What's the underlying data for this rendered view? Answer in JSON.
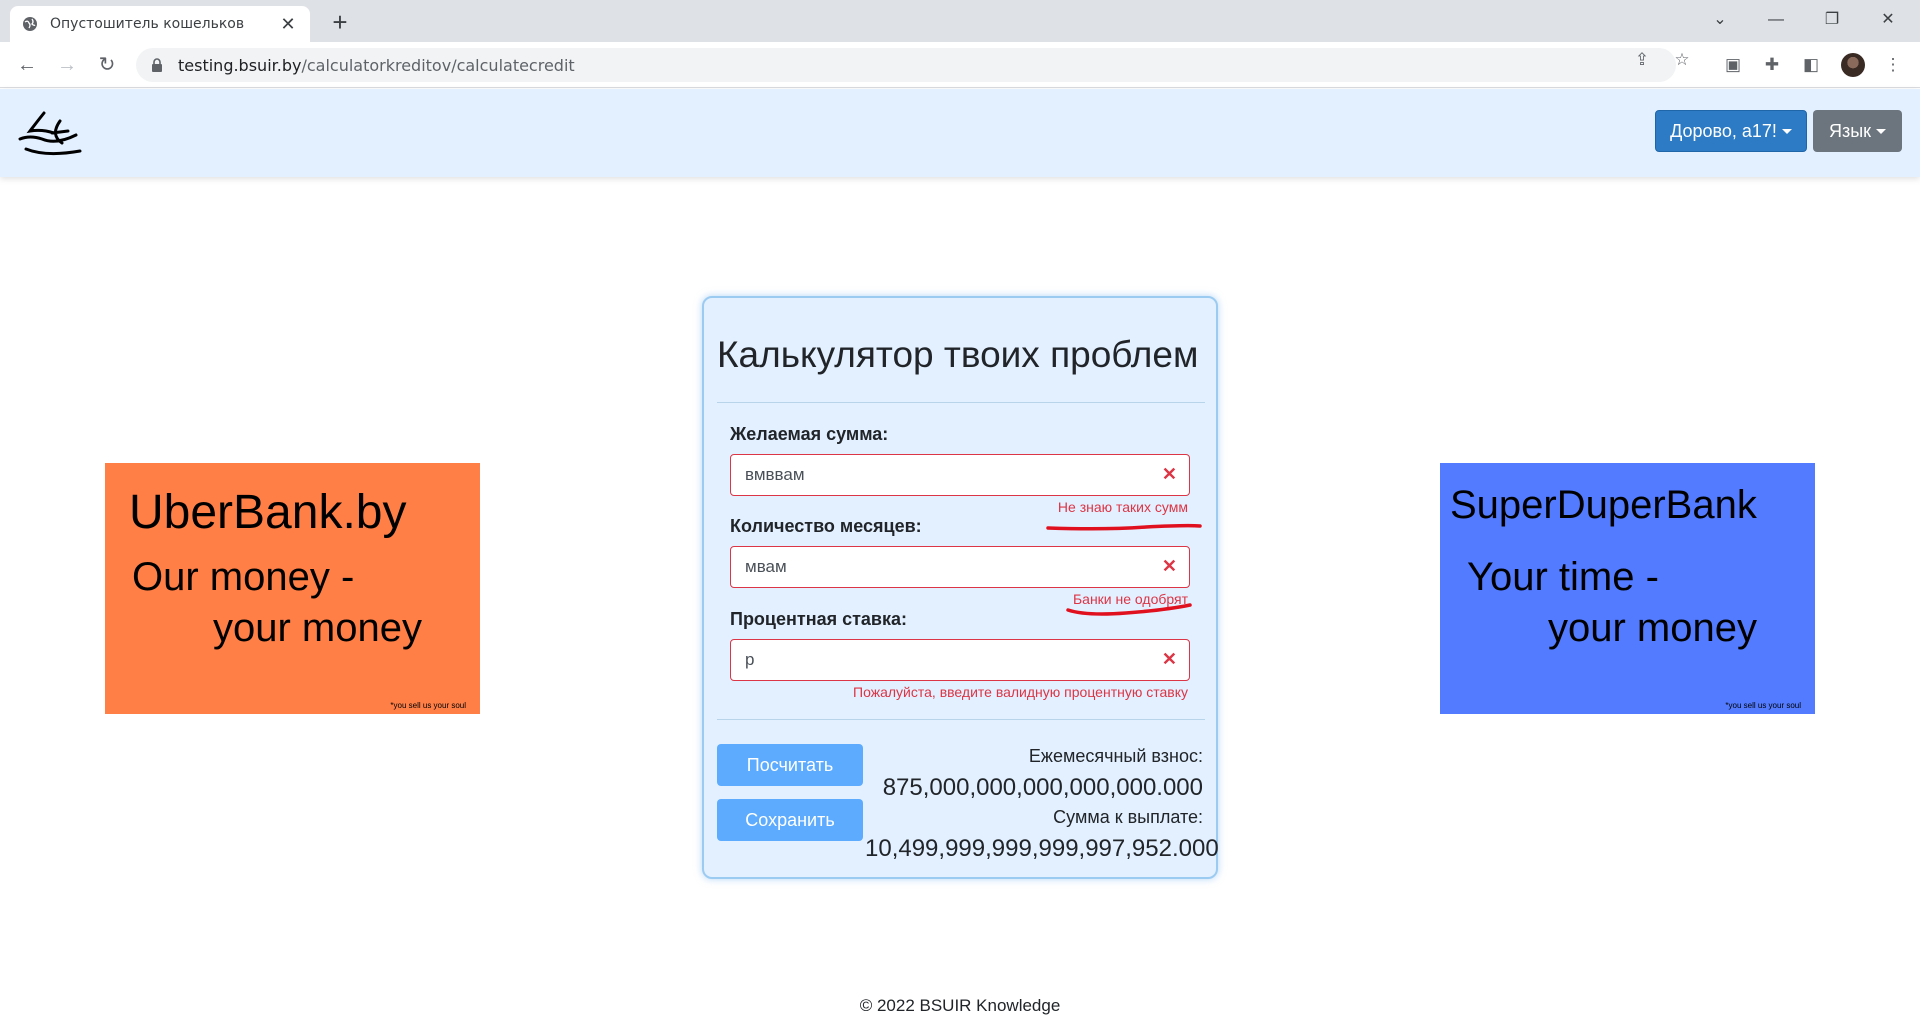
{
  "browser": {
    "tab_title": "Опустошитель кошельков",
    "url_host": "testing.bsuir.by",
    "url_path": "/calculatorkreditov/calculatecredit"
  },
  "header": {
    "user_button": "Дорово, a17!",
    "language_button": "Язык"
  },
  "ads": {
    "left": {
      "title": "UberBank.by",
      "line1": "Our money -",
      "line2": "your money",
      "fine_print": "*you sell us your soul",
      "color": "#ff7f47"
    },
    "right": {
      "title": "SuperDuperBank",
      "line1": "Your time -",
      "line2": "your money",
      "fine_print": "*you sell us your soul",
      "color": "#537bff"
    }
  },
  "calculator": {
    "title": "Калькулятор твоих проблем",
    "amount": {
      "label": "Желаемая сумма:",
      "value": "вмввам",
      "error": "Не знаю таких сумм"
    },
    "months": {
      "label": "Количество месяцев:",
      "value": "мвам",
      "error": "Банки не одобрят"
    },
    "rate": {
      "label": "Процентная ставка:",
      "value": "р",
      "error": "Пожалуйста, введите валидную процентную ставку"
    },
    "calculate_button": "Посчитать",
    "save_button": "Сохранить",
    "monthly_label": "Ежемесячный взнос:",
    "monthly_value": "875,000,000,000,000,000.000",
    "total_label": "Сумма к выплате:",
    "total_value": "10,499,999,999,999,997,952.000"
  },
  "footer": {
    "text": "© 2022 BSUIR Knowledge"
  },
  "colors": {
    "header_bg": "#e3f0ff",
    "primary_button": "#2c7bc4",
    "action_button": "#5cabff",
    "error": "#dc3545"
  }
}
